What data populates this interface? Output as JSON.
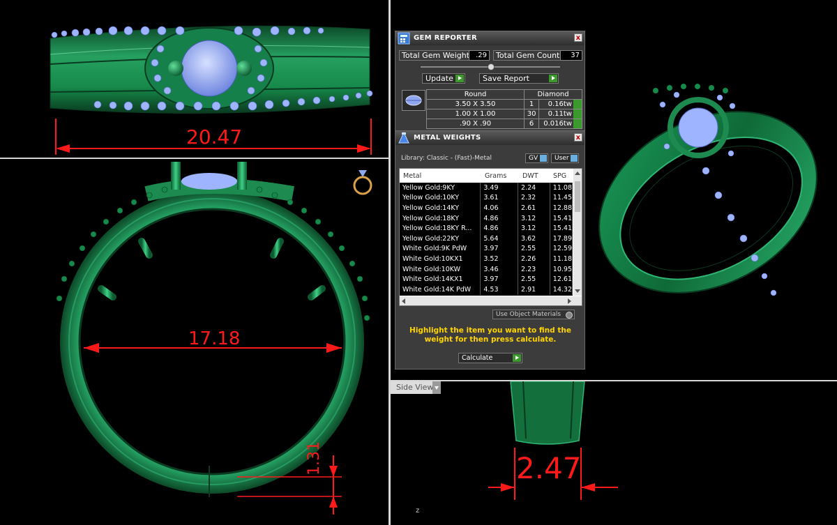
{
  "dimensions": {
    "top_width": "20.47",
    "inner_diameter": "17.18",
    "thickness": "1.31",
    "side_width": "2.47"
  },
  "gem_reporter": {
    "title": "GEM REPORTER",
    "close": "x",
    "total_weight_label": "Total Gem Weight",
    "total_weight_value": ".29",
    "total_count_label": "Total Gem Count",
    "total_count_value": "37",
    "update_label": "Update",
    "save_report_label": "Save Report",
    "table_header": {
      "shape": "Round",
      "material": "Diamond"
    },
    "rows": [
      {
        "size": "3.50 X 3.50",
        "count": "1",
        "weight": "0.16tw"
      },
      {
        "size": "1.00 X 1.00",
        "count": "30",
        "weight": "0.11tw"
      },
      {
        "size": ".90 X .90",
        "count": "6",
        "weight": "0.016tw"
      }
    ]
  },
  "metal_weights": {
    "title": "METAL WEIGHTS",
    "close": "x",
    "library": "Library: Classic - (Fast)-Metal",
    "gv_label": "GV",
    "user_label": "User",
    "columns": [
      "Metal",
      "Grams",
      "DWT",
      "SPG"
    ],
    "rows": [
      {
        "metal": "Yellow Gold:9KY",
        "grams": "3.49",
        "dwt": "2.24",
        "spg": "11.08"
      },
      {
        "metal": "Yellow Gold:10KY",
        "grams": "3.61",
        "dwt": "2.32",
        "spg": "11.45"
      },
      {
        "metal": "Yellow Gold:14KY",
        "grams": "4.06",
        "dwt": "2.61",
        "spg": "12.88"
      },
      {
        "metal": "Yellow Gold:18KY",
        "grams": "4.86",
        "dwt": "3.12",
        "spg": "15.41"
      },
      {
        "metal": "Yellow Gold:18KY R...",
        "grams": "4.86",
        "dwt": "3.12",
        "spg": "15.41"
      },
      {
        "metal": "Yellow Gold:22KY",
        "grams": "5.64",
        "dwt": "3.62",
        "spg": "17.89"
      },
      {
        "metal": "White Gold:9K PdW",
        "grams": "3.97",
        "dwt": "2.55",
        "spg": "12.59"
      },
      {
        "metal": "White Gold:10KX1",
        "grams": "3.52",
        "dwt": "2.26",
        "spg": "11.18"
      },
      {
        "metal": "White Gold:10KW",
        "grams": "3.46",
        "dwt": "2.23",
        "spg": "10.95"
      },
      {
        "metal": "White Gold:14KX1",
        "grams": "3.97",
        "dwt": "2.55",
        "spg": "12.61"
      },
      {
        "metal": "White Gold:14K PdW",
        "grams": "4.53",
        "dwt": "2.91",
        "spg": "14.32"
      }
    ],
    "use_object_materials": "Use Object Materials",
    "hint": "Highlight the item you want to find the weight for then press calculate.",
    "calculate_label": "Calculate"
  },
  "side_view_label": "Side View",
  "axis_label": "z",
  "colors": {
    "ring_green": "#1f8a4e",
    "ring_dark": "#0d4f2a",
    "gem_blue": "#8fa6f0",
    "dimension_red": "#ff1a1a",
    "hint_yellow": "#ffd400"
  }
}
